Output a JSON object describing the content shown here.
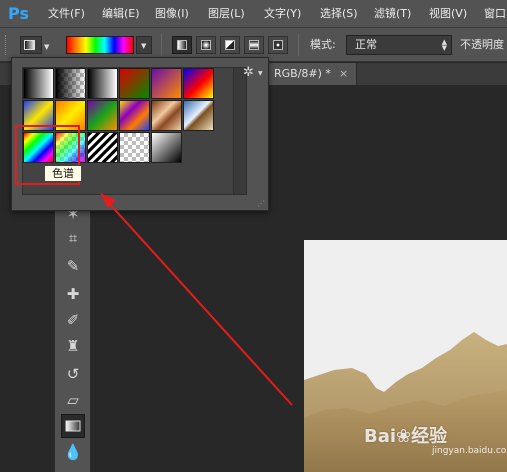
{
  "app": {
    "logo": "Ps"
  },
  "menu": [
    "文件(F)",
    "编辑(E)",
    "图像(I)",
    "图层(L)",
    "文字(Y)",
    "选择(S)",
    "滤镜(T)",
    "视图(V)",
    "窗口"
  ],
  "options": {
    "mode_label": "模式:",
    "mode_value": "正常",
    "opacity_label": "不透明度",
    "gradient_types": [
      "linear-gradient",
      "radial-gradient",
      "angle-gradient",
      "reflected-gradient",
      "diamond-gradient"
    ],
    "active_gradient_type": "linear-gradient"
  },
  "document": {
    "tab_title": "RGB/8#) *",
    "close": "×"
  },
  "gradient_picker": {
    "tooltip": "色谱",
    "presets": [
      "foreground-to-background",
      "foreground-to-transparent",
      "black-white",
      "red-green",
      "violet-orange",
      "blue-red-yellow",
      "blue-yellow-blue",
      "orange-yellow-orange",
      "violet-green-orange",
      "yellow-violet-orange-blue",
      "copper",
      "chrome",
      "spectrum",
      "transparent-rainbow",
      "transparent-stripes",
      "transparent-checker",
      "black-to-white"
    ],
    "selected": "spectrum"
  },
  "watermark": {
    "text": "Bai❀经验",
    "sub": "jingyan.baidu.com"
  },
  "colors": {
    "annotation_red": "#e41c1c",
    "panel": "#535353",
    "canvas": "#282828"
  }
}
